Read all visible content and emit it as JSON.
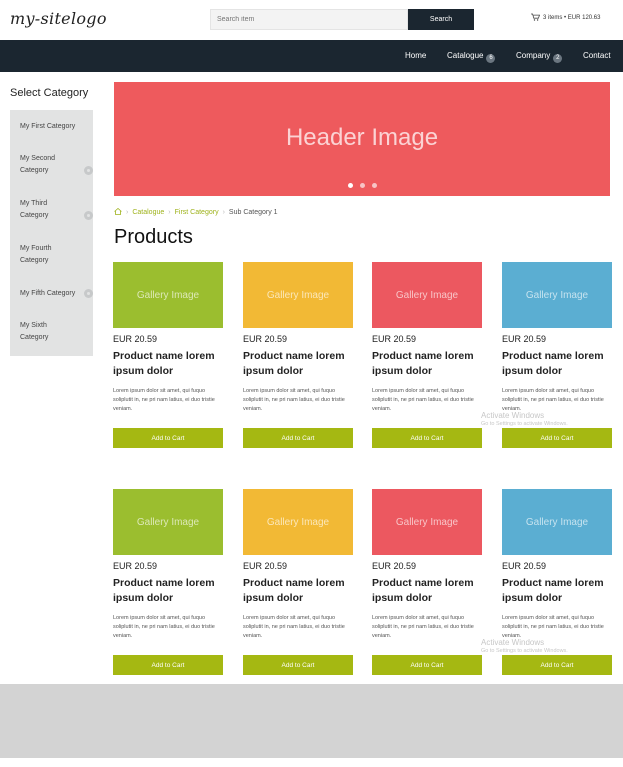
{
  "header": {
    "logo": "my-sitelogo",
    "search_placeholder": "Search item",
    "search_button": "Search",
    "cart_text": "3 items • EUR 120.63"
  },
  "nav": {
    "items": [
      {
        "label": "Home",
        "badge": ""
      },
      {
        "label": "Catalogue",
        "badge": "6"
      },
      {
        "label": "Company",
        "badge": "2"
      },
      {
        "label": "Contact",
        "badge": ""
      }
    ]
  },
  "sidebar": {
    "title": "Select Category",
    "items": [
      {
        "label": "My First Category",
        "expandable": false
      },
      {
        "label": "My Second Category",
        "expandable": true
      },
      {
        "label": "My Third Category",
        "expandable": true
      },
      {
        "label": "My Fourth Category",
        "expandable": false
      },
      {
        "label": "My Fifth Category",
        "expandable": true
      },
      {
        "label": "My Sixth Category",
        "expandable": false
      }
    ]
  },
  "hero": {
    "text": "Header Image",
    "slides": 3,
    "active_slide": 1
  },
  "breadcrumb": {
    "items": [
      "Catalogue",
      "First Category",
      "Sub Category 1"
    ]
  },
  "page_title": "Products",
  "products": [
    {
      "image_label": "Gallery Image",
      "color": "#9bbe2f",
      "price": "EUR 20.59",
      "name": "Product name lorem ipsum dolor",
      "description": "Lorem ipsum dolor sit amet, qui fuquo soliplutit in, ne pri nam latius, ei duo tristie veniam.",
      "button": "Add to Cart"
    },
    {
      "image_label": "Gallery Image",
      "color": "#f2b935",
      "price": "EUR 20.59",
      "name": "Product name lorem ipsum dolor",
      "description": "Lorem ipsum dolor sit amet, qui fuquo soliplutit in, ne pri nam latius, ei duo tristie veniam.",
      "button": "Add to Cart"
    },
    {
      "image_label": "Gallery Image",
      "color": "#ec5860",
      "price": "EUR 20.59",
      "name": "Product name lorem ipsum dolor",
      "description": "Lorem ipsum dolor sit amet, qui fuquo soliplutit in, ne pri nam latius, ei duo tristie veniam.",
      "button": "Add to Cart"
    },
    {
      "image_label": "Gallery Image",
      "color": "#5baed2",
      "price": "EUR 20.59",
      "name": "Product name lorem ipsum dolor",
      "description": "Lorem ipsum dolor sit amet, qui fuquo soliplutit in, ne pri nam latius, ei duo tristie veniam.",
      "button": "Add to Cart"
    },
    {
      "image_label": "Gallery Image",
      "color": "#9bbe2f",
      "price": "EUR 20.59",
      "name": "Product name lorem ipsum dolor",
      "description": "Lorem ipsum dolor sit amet, qui fuquo soliplutit in, ne pri nam latius, ei duo tristie veniam.",
      "button": "Add to Cart"
    },
    {
      "image_label": "Gallery Image",
      "color": "#f2b935",
      "price": "EUR 20.59",
      "name": "Product name lorem ipsum dolor",
      "description": "Lorem ipsum dolor sit amet, qui fuquo soliplutit in, ne pri nam latius, ei duo tristie veniam.",
      "button": "Add to Cart"
    },
    {
      "image_label": "Gallery Image",
      "color": "#ec5860",
      "price": "EUR 20.59",
      "name": "Product name lorem ipsum dolor",
      "description": "Lorem ipsum dolor sit amet, qui fuquo soliplutit in, ne pri nam latius, ei duo tristie veniam.",
      "button": "Add to Cart"
    },
    {
      "image_label": "Gallery Image",
      "color": "#5baed2",
      "price": "EUR 20.59",
      "name": "Product name lorem ipsum dolor",
      "description": "Lorem ipsum dolor sit amet, qui fuquo soliplutit in, ne pri nam latius, ei duo tristie veniam.",
      "button": "Add to Cart"
    }
  ],
  "watermark": {
    "title": "Activate Windows",
    "subtitle": "Go to Settings to activate Windows."
  },
  "colors": {
    "nav_background": "#1b2630",
    "accent_green": "#a5b812",
    "hero_red": "#ee5a5d",
    "sidebar_background": "#e2e3e3"
  },
  "icons": {
    "cart": "cart-icon",
    "home": "home-icon",
    "expand": "expand-circle-icon"
  }
}
